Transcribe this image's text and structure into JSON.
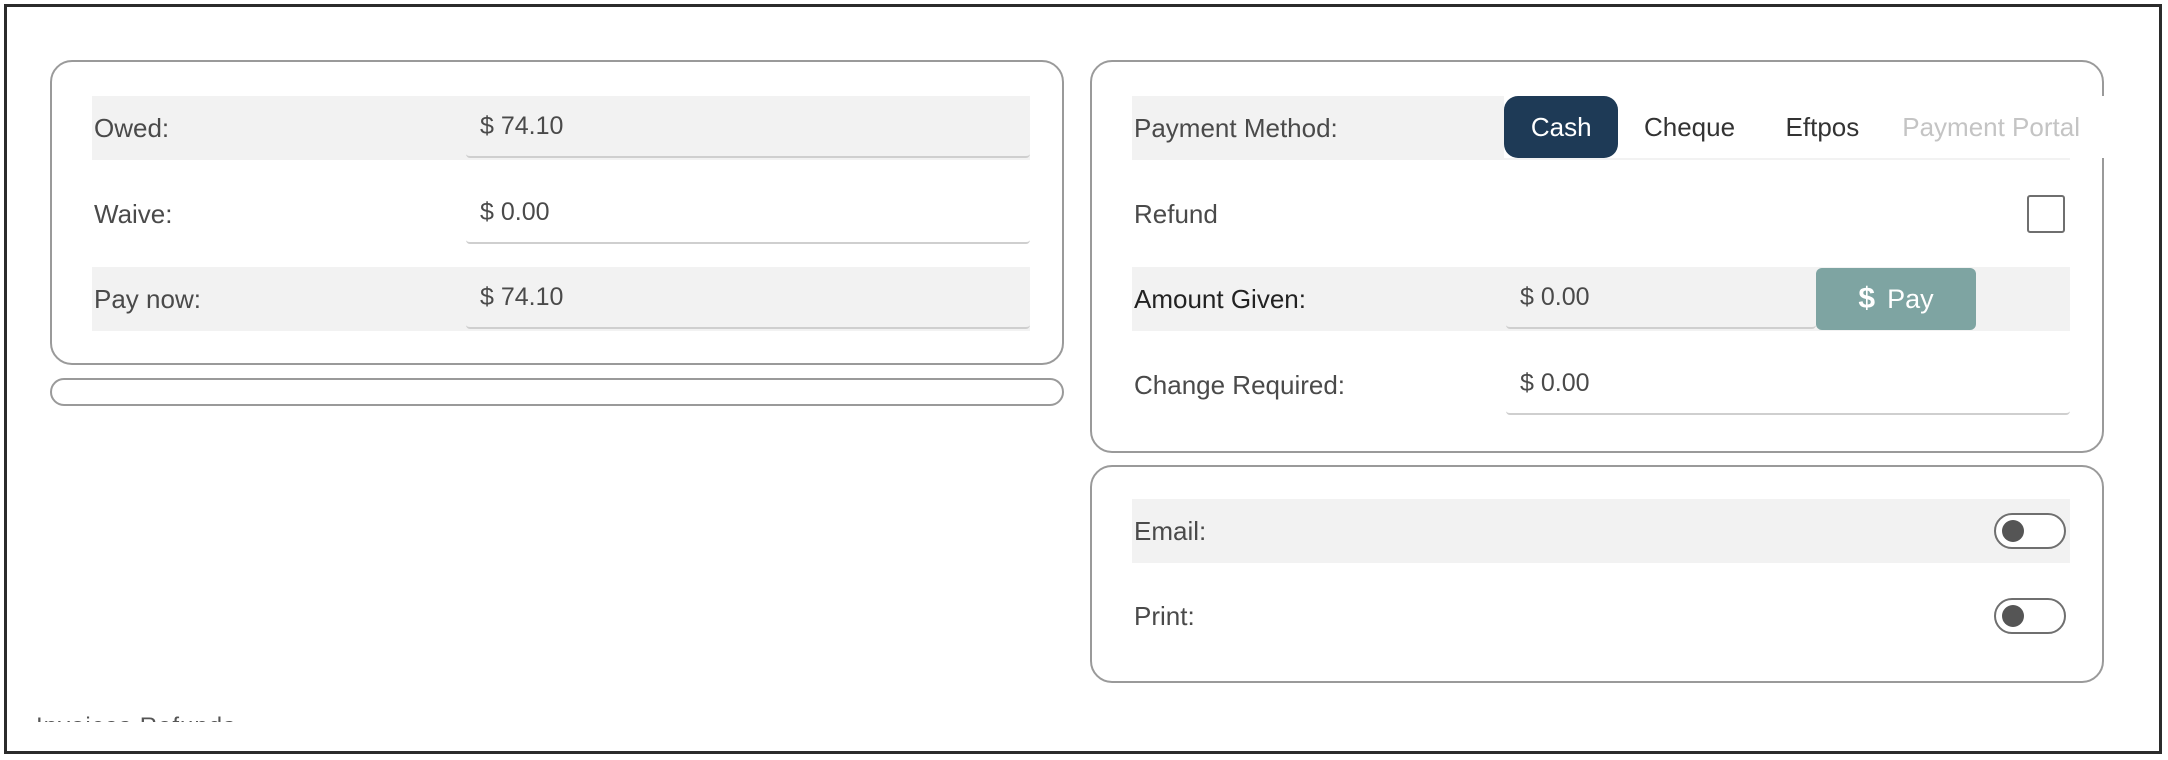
{
  "left_panel": {
    "owed_label": "Owed:",
    "owed_value": "$ 74.10",
    "waive_label": "Waive:",
    "waive_value": "$ 0.00",
    "pay_now_label": "Pay now:",
    "pay_now_value": "$ 74.10"
  },
  "payment_panel": {
    "method_label": "Payment Method:",
    "methods": [
      {
        "label": "Cash",
        "state": "selected"
      },
      {
        "label": "Cheque",
        "state": "normal"
      },
      {
        "label": "Eftpos",
        "state": "normal"
      },
      {
        "label": "Payment Portal",
        "state": "disabled"
      }
    ],
    "refund_label": "Refund",
    "refund_checked": false,
    "amount_given_label": "Amount Given:",
    "amount_given_value": "$ 0.00",
    "pay_button_icon": "dollar-icon",
    "pay_button_label": "Pay",
    "change_required_label": "Change Required:",
    "change_required_value": "$ 0.00"
  },
  "receipt_panel": {
    "email_label": "Email:",
    "email_on": false,
    "print_label": "Print:",
    "print_on": false
  },
  "bottom_tabs_cutoff": "Invoices     Refunds",
  "colors": {
    "selected_method_bg": "#1e3a56",
    "pay_button_bg": "#7ea4a2",
    "row_shade": "#f2f2f2",
    "border": "#9a9a9a"
  }
}
